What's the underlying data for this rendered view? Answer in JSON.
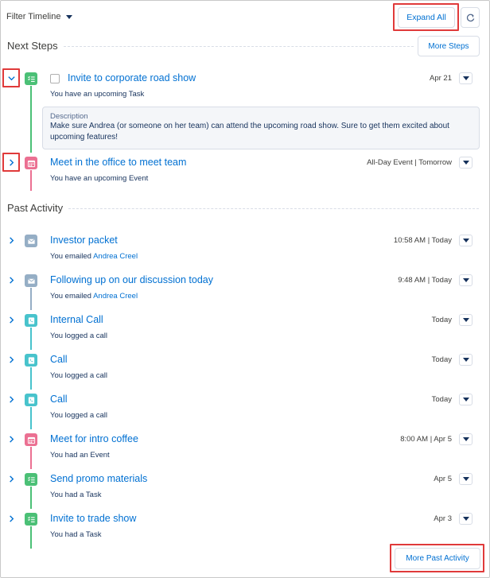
{
  "header": {
    "filter_label": "Filter Timeline",
    "expand_all_label": "Expand All"
  },
  "next_steps": {
    "title": "Next Steps",
    "more_label": "More Steps",
    "items": [
      {
        "title": "Invite to corporate road show",
        "subtitle": "You have an upcoming Task",
        "date": "Apr 21",
        "description_label": "Description",
        "description": "Make sure Andrea (or someone on her team) can attend the upcoming road show.  Sure to get them excited about upcoming features!"
      },
      {
        "title": "Meet in the office to meet team",
        "subtitle": "You have an upcoming Event",
        "date": "All-Day Event | Tomorrow"
      }
    ]
  },
  "past_activity": {
    "title": "Past Activity",
    "more_label": "More Past Activity",
    "items": [
      {
        "title": "Investor packet",
        "subtitle_prefix": "You emailed",
        "subtitle_link": "Andrea Creel",
        "date": "10:58 AM | Today"
      },
      {
        "title": "Following up on our discussion today",
        "subtitle_prefix": "You emailed",
        "subtitle_link": "Andrea Creel",
        "date": "9:48 AM | Today"
      },
      {
        "title": "Internal Call",
        "subtitle": "You logged a call",
        "date": "Today"
      },
      {
        "title": "Call",
        "subtitle": "You logged a call",
        "date": "Today"
      },
      {
        "title": "Call",
        "subtitle": "You logged a call",
        "date": "Today"
      },
      {
        "title": "Meet for intro coffee",
        "subtitle": "You had an Event",
        "date": "8:00 AM | Apr 5"
      },
      {
        "title": "Send promo materials",
        "subtitle": "You had a Task",
        "date": "Apr 5"
      },
      {
        "title": "Invite to trade show",
        "subtitle": "You had a Task",
        "date": "Apr 3"
      }
    ]
  },
  "colors": {
    "task": "#4bc076",
    "event": "#eb7092",
    "email": "#95aec5",
    "call": "#48c3cc",
    "link": "#0070d2",
    "highlight": "#e03a3a"
  },
  "icons": {
    "task": "task-icon",
    "event": "event-icon",
    "email": "email-icon",
    "call": "call-icon",
    "refresh": "refresh-icon",
    "expand": "chevron-right-icon",
    "collapse": "chevron-down-icon"
  }
}
